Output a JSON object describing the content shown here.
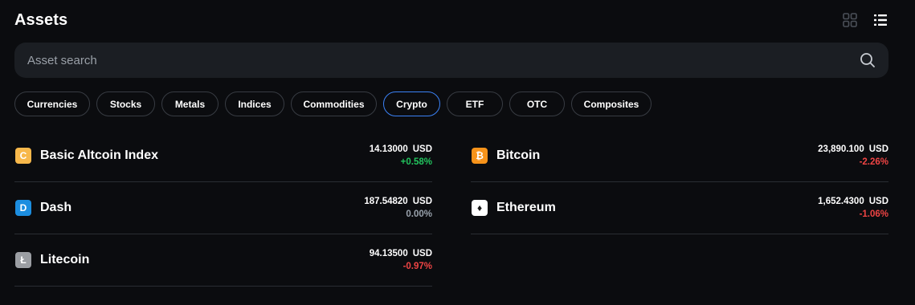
{
  "header": {
    "title": "Assets",
    "grid_icon": "grid-view-icon",
    "list_icon": "list-view-icon"
  },
  "search": {
    "placeholder": "Asset search",
    "value": "",
    "icon": "search-icon"
  },
  "filters": [
    {
      "label": "Currencies",
      "active": false
    },
    {
      "label": "Stocks",
      "active": false
    },
    {
      "label": "Metals",
      "active": false
    },
    {
      "label": "Indices",
      "active": false
    },
    {
      "label": "Commodities",
      "active": false
    },
    {
      "label": "Crypto",
      "active": true
    },
    {
      "label": "ETF",
      "active": false
    },
    {
      "label": "OTC",
      "active": false
    },
    {
      "label": "Composites",
      "active": false
    }
  ],
  "assets": {
    "left": [
      {
        "name": "Basic Altcoin Index",
        "price": "14.13000",
        "unit": "USD",
        "change": "+0.58%",
        "trend": "up",
        "icon": "altcoin-index-icon",
        "icon_color": "#f7b84b",
        "icon_glyph": "C"
      },
      {
        "name": "Dash",
        "price": "187.54820",
        "unit": "USD",
        "change": "0.00%",
        "trend": "flat",
        "icon": "dash-icon",
        "icon_color": "#1c8ee0",
        "icon_glyph": "D"
      },
      {
        "name": "Litecoin",
        "price": "94.13500",
        "unit": "USD",
        "change": "-0.97%",
        "trend": "down",
        "icon": "litecoin-icon",
        "icon_color": "#9b9ea3",
        "icon_glyph": "Ł"
      }
    ],
    "right": [
      {
        "name": "Bitcoin",
        "price": "23,890.100",
        "unit": "USD",
        "change": "-2.26%",
        "trend": "down",
        "icon": "bitcoin-icon",
        "icon_color": "#f7931a",
        "icon_glyph": "₿"
      },
      {
        "name": "Ethereum",
        "price": "1,652.4300",
        "unit": "USD",
        "change": "-1.06%",
        "trend": "down",
        "icon": "ethereum-icon",
        "icon_color": "#ffffff",
        "icon_glyph": "♦"
      }
    ]
  },
  "colors": {
    "background": "#0b0c0f",
    "accent": "#3b82f6",
    "positive": "#22c55e",
    "negative": "#ef4444",
    "neutral": "#9aa3ad"
  }
}
